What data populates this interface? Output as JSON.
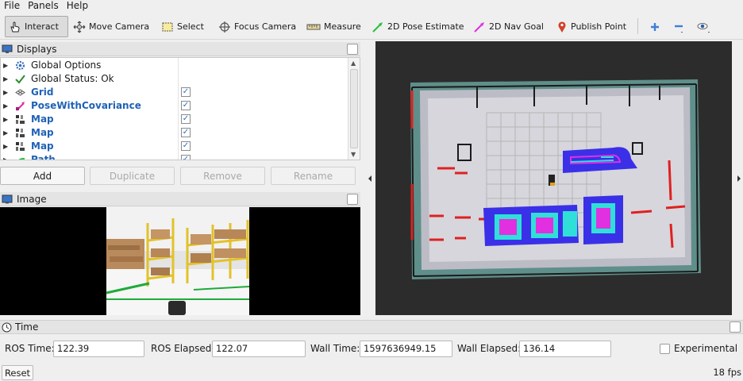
{
  "menu": [
    "File",
    "Panels",
    "Help"
  ],
  "toolbar": {
    "interact": "Interact",
    "move_camera": "Move Camera",
    "select": "Select",
    "focus_camera": "Focus Camera",
    "measure": "Measure",
    "pose_estimate": "2D Pose Estimate",
    "nav_goal": "2D Nav Goal",
    "publish_point": "Publish Point"
  },
  "displays": {
    "title": "Displays",
    "items": [
      {
        "label": "Global Options",
        "icon": "gear-icon",
        "checked": null
      },
      {
        "label": "Global Status: Ok",
        "icon": "check-icon",
        "checked": null
      },
      {
        "label": "Grid",
        "icon": "grid-icon",
        "checked": true
      },
      {
        "label": "PoseWithCovariance",
        "icon": "pose-icon",
        "checked": true
      },
      {
        "label": "Map",
        "icon": "map-icon",
        "checked": true
      },
      {
        "label": "Map",
        "icon": "map-icon",
        "checked": true
      },
      {
        "label": "Map",
        "icon": "map-icon",
        "checked": true
      },
      {
        "label": "Path",
        "icon": "path-icon",
        "checked": true
      }
    ],
    "checkmark": "✓",
    "buttons": {
      "add": "Add",
      "duplicate": "Duplicate",
      "remove": "Remove",
      "rename": "Rename"
    }
  },
  "image_panel": {
    "title": "Image"
  },
  "time": {
    "title": "Time",
    "ros_time_label": "ROS Time:",
    "ros_time": "122.39",
    "ros_elapsed_label": "ROS Elapsed:",
    "ros_elapsed": "122.07",
    "wall_time_label": "Wall Time:",
    "wall_time": "1597636949.15",
    "wall_elapsed_label": "Wall Elapsed:",
    "wall_elapsed": "136.14",
    "experimental_label": "Experimental",
    "reset": "Reset",
    "fps": "18 fps"
  },
  "colors": {
    "accent_blue": "#1f62b5",
    "costmap_blue": "#3a30e8",
    "costmap_cyan": "#2fe0d8",
    "costmap_magenta": "#e030e0",
    "obstacle_red": "#e02020",
    "nav_goal_magenta": "#e030e0",
    "pose_estimate_green": "#29c040"
  }
}
